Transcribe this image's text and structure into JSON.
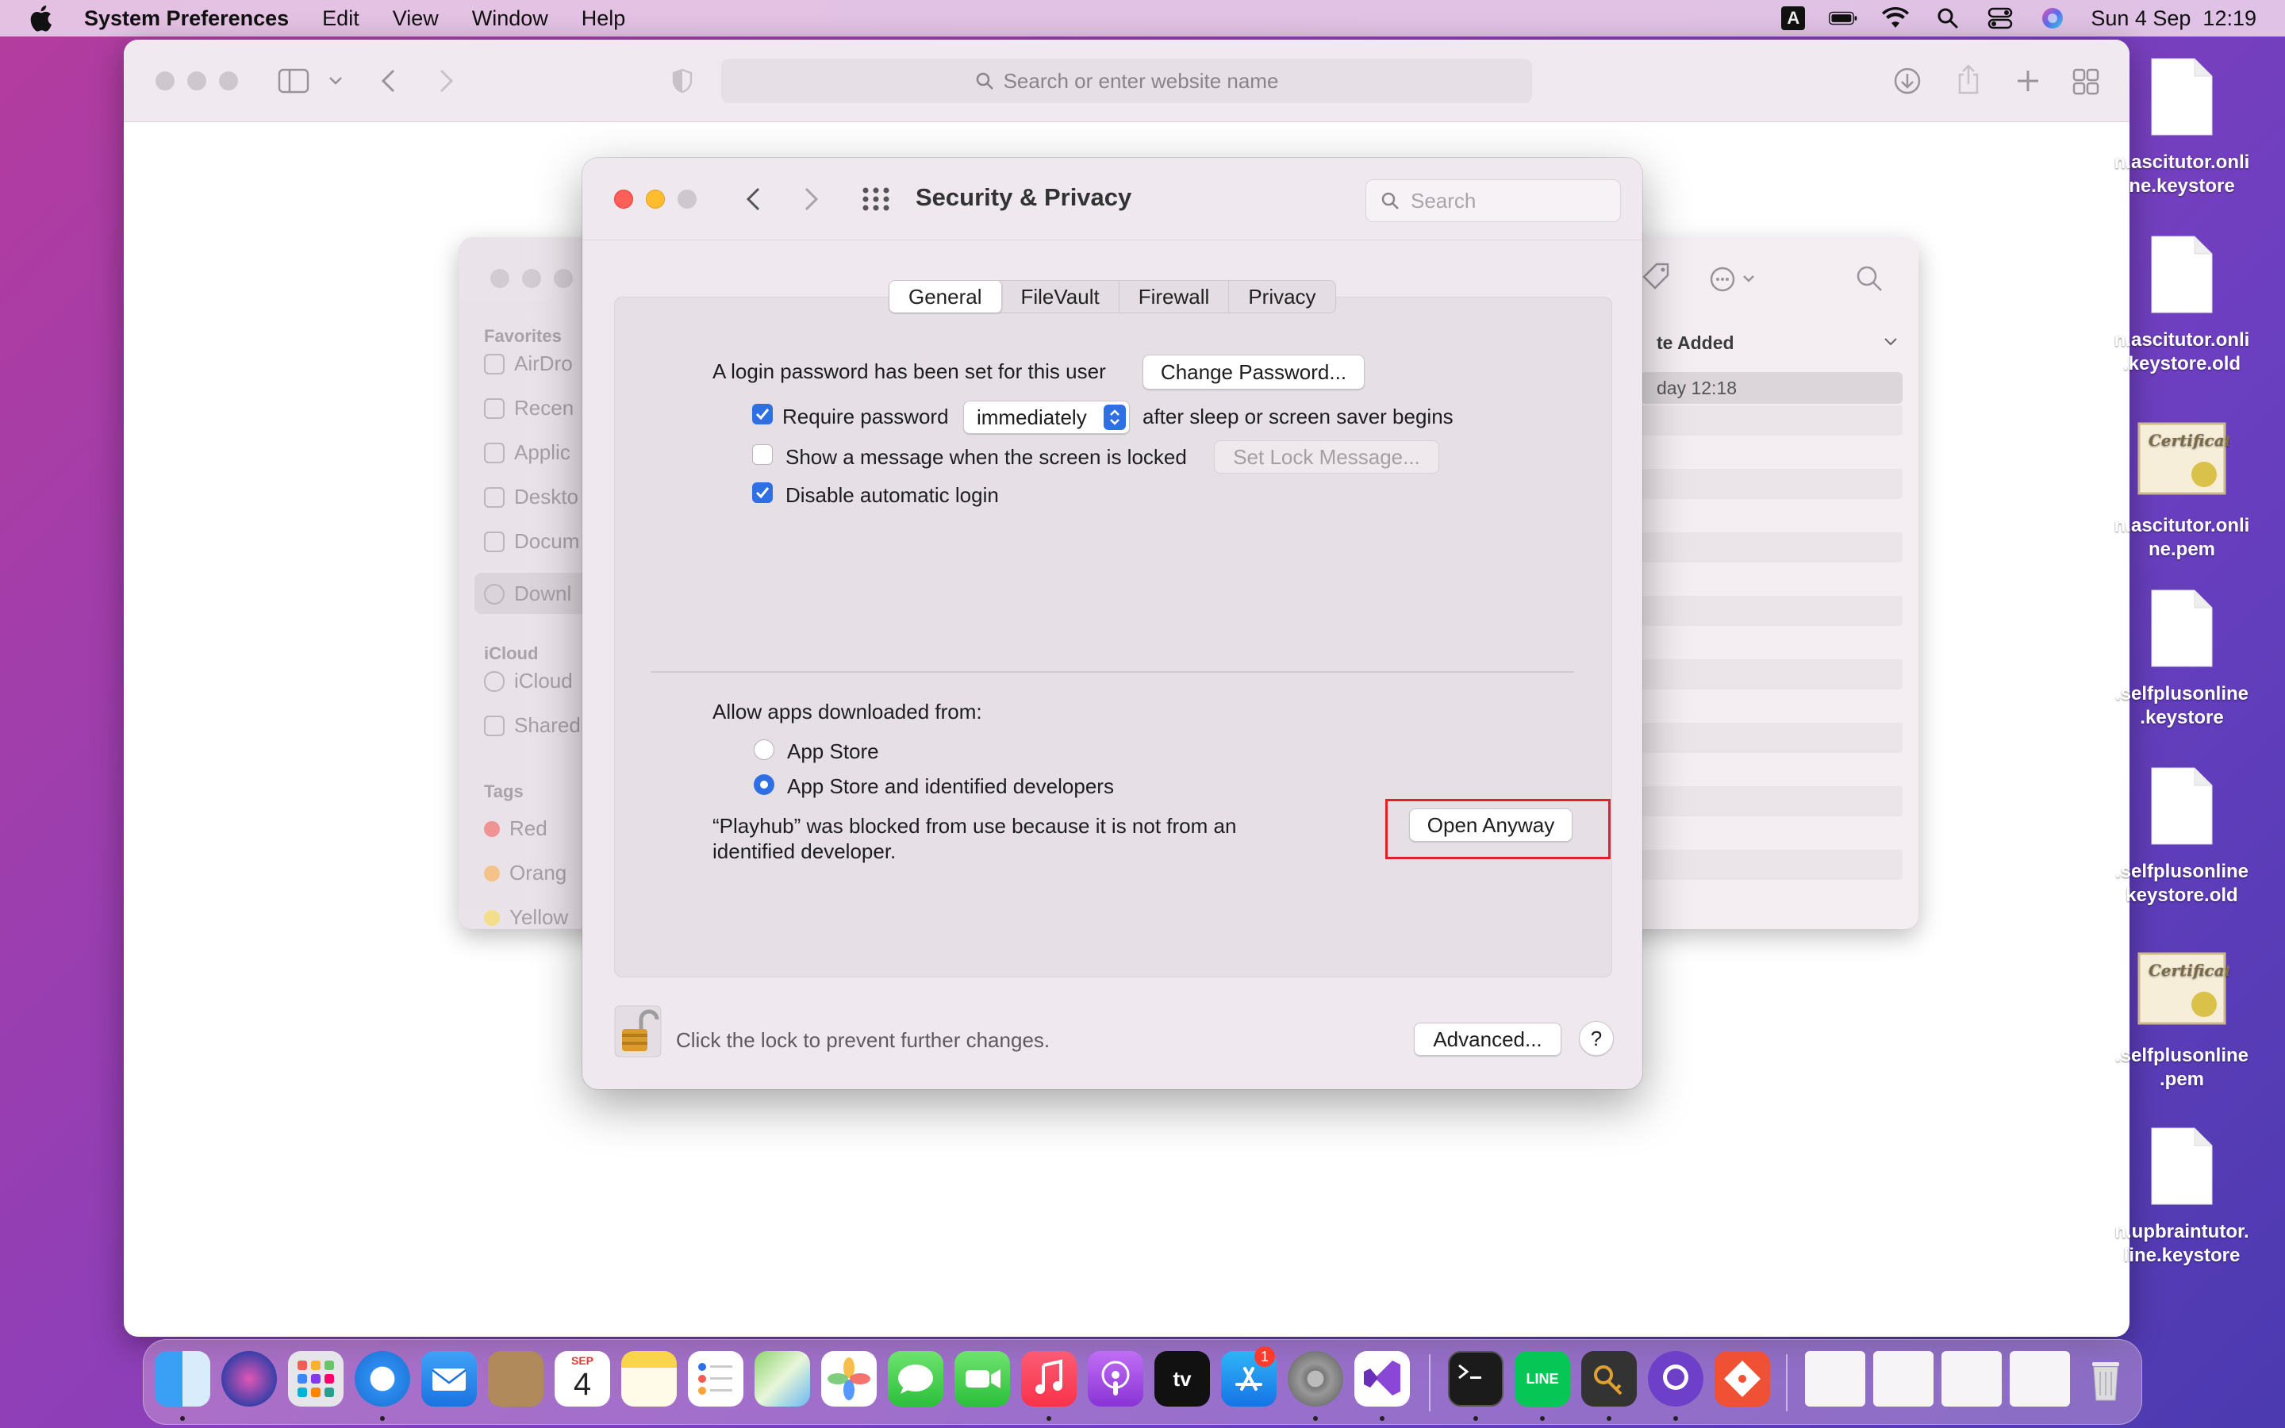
{
  "menubar": {
    "app_name": "System Preferences",
    "menus": [
      "Edit",
      "View",
      "Window",
      "Help"
    ],
    "input_indicator": "A",
    "datetime": "Sun 4 Sep  12:19"
  },
  "safari": {
    "url_placeholder": "Search or enter website name"
  },
  "finder": {
    "sidebar": {
      "favorites_header": "Favorites",
      "favorites": [
        "AirDro",
        "Recen",
        "Applic",
        "Deskto",
        "Docum",
        "Downl"
      ],
      "icloud_header": "iCloud",
      "icloud": [
        "iCloud",
        "Shared"
      ],
      "tags_header": "Tags",
      "tags": [
        {
          "label": "Red",
          "color": "#ff5f57"
        },
        {
          "label": "Orang",
          "color": "#f7a23b"
        },
        {
          "label": "Yellow",
          "color": "#f5d23a"
        }
      ]
    },
    "column_header": "te Added",
    "selected_row": "day 12:18"
  },
  "prefs": {
    "title": "Security & Privacy",
    "search_placeholder": "Search",
    "tabs": [
      "General",
      "FileVault",
      "Firewall",
      "Privacy"
    ],
    "active_tab": "General",
    "general": {
      "login_text": "A login password has been set for this user",
      "change_password_button": "Change Password...",
      "require_password_label": "Require password",
      "require_password_value": "immediately",
      "after_sleep_text": "after sleep or screen saver begins",
      "show_message_label": "Show a message when the screen is locked",
      "set_lock_message_button": "Set Lock Message...",
      "disable_autologin_label": "Disable automatic login",
      "allow_apps_label": "Allow apps downloaded from:",
      "radio_app_store": "App Store",
      "radio_identified": "App Store and identified developers",
      "blocked_line1": "“Playhub” was blocked from use because it is not from an",
      "blocked_line2": "identified developer.",
      "open_anyway_button": "Open Anyway"
    },
    "footer": {
      "lock_text": "Click the lock to prevent further changes.",
      "advanced_button": "Advanced...",
      "help_button": "?"
    }
  },
  "desktop_icons": [
    [
      "n.ascitutor.onli",
      "ne.keystore"
    ],
    [
      "n.ascitutor.onli",
      ".keystore.old"
    ],
    [
      "n.ascitutor.onli",
      "ne.pem"
    ],
    [
      ".selfplusonline",
      ".keystore"
    ],
    [
      ".selfplusonline",
      "keystore.old"
    ],
    [
      ".selfplusonline",
      ".pem"
    ],
    [
      "n.upbraintutor.",
      "line.keystore"
    ]
  ],
  "desktop_icon_certificate_text": "Certificate",
  "dock": {
    "calendar_month": "SEP",
    "calendar_day": "4",
    "appstore_badge": "1",
    "tv_label": "tv",
    "line_label": "LINE"
  }
}
